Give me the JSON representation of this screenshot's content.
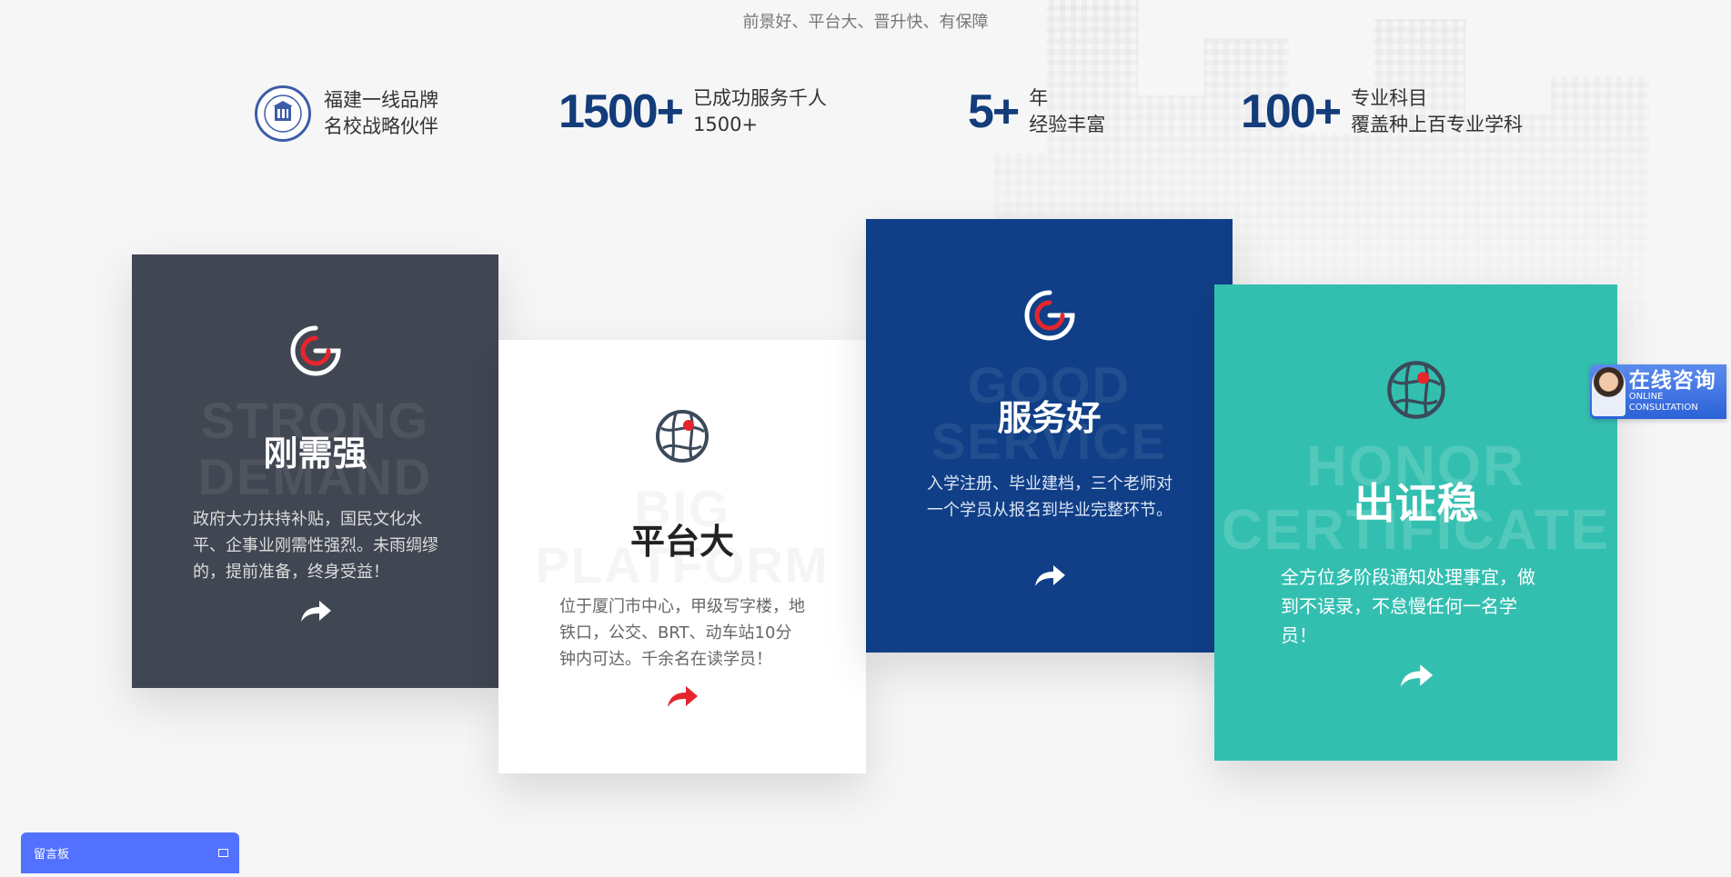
{
  "tagline": "前景好、平台大、晋升快、有保障",
  "stats": [
    {
      "number": "",
      "line1": "福建一线品牌",
      "line2": "名校战略伙伴",
      "icon": "university-seal-icon"
    },
    {
      "number": "1500+",
      "line1": "已成功服务千人",
      "line2": "1500+"
    },
    {
      "number": "5+",
      "line1": "年",
      "line2": "经验丰富"
    },
    {
      "number": "100+",
      "line1": "专业科目",
      "line2": "覆盖种上百专业学科"
    }
  ],
  "cards": [
    {
      "bg_line1": "STRONG",
      "bg_line2": "DEMAND",
      "title": "刚需强",
      "desc": "政府大力扶持补贴，国民文化水平、企事业刚需性强烈。未雨绸缪的，提前准备，终身受益！",
      "bg": "#404652",
      "icon": "target-icon"
    },
    {
      "bg_line1": "BIG",
      "bg_line2": "PLATFORM",
      "title": "平台大",
      "desc": "位于厦门市中心，甲级写字楼，地铁口，公交、BRT、动车站10分钟内可达。千余名在读学员！",
      "bg": "#ffffff",
      "icon": "globe-icon"
    },
    {
      "bg_line1": "GOOD",
      "bg_line2": "SERVICE",
      "title": "服务好",
      "desc": "入学注册、毕业建档，三个老师对一个学员从报名到毕业完整环节。",
      "bg": "#103f87",
      "icon": "target-icon"
    },
    {
      "bg_line1": "HONOR",
      "bg_line2": "CERTIFICATE",
      "title": "出证稳",
      "desc": "全方位多阶段通知处理事宜，做到不误录，不怠慢任何一名学员！",
      "bg": "#33bfb0",
      "icon": "globe-icon"
    }
  ],
  "consult": {
    "cn": "在线咨询",
    "en": "ONLINE CONSULTATION"
  },
  "message_board": {
    "label": "留言板"
  },
  "colors": {
    "accent_red": "#e5262d",
    "navy": "#133c7a",
    "teal": "#33bfb0",
    "bar_blue": "#5271ff"
  }
}
